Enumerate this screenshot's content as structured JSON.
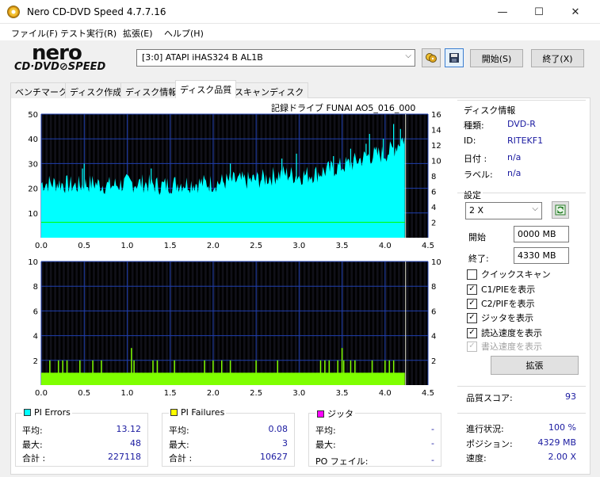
{
  "window": {
    "title": "Nero CD-DVD Speed 4.7.7.16",
    "minimize": "—",
    "maximize": "☐",
    "close": "✕"
  },
  "menu": [
    "ファイル(F)",
    "テスト実行(R)",
    "拡張(E)",
    "ヘルプ(H)"
  ],
  "logo": {
    "brand": "nero",
    "product": "CD·DVD⊘SPEED"
  },
  "toolbar": {
    "drive": "[3:0]   ATAPI iHAS324   B AL1B",
    "start_label": "開始(S)",
    "exit_label": "終了(X)"
  },
  "tabs": [
    "ベンチマーク",
    "ディスク作成",
    "ディスク情報",
    "ディスク品質",
    "スキャンディスク"
  ],
  "active_tab": 3,
  "chart_header": "記録ドライブ FUNAI    AO5_016_000",
  "chart_data": [
    {
      "type": "area",
      "name": "PI Errors",
      "x_ticks": [
        "0.0",
        "0.5",
        "1.0",
        "1.5",
        "2.0",
        "2.5",
        "3.0",
        "3.5",
        "4.0",
        "4.5"
      ],
      "xlim": [
        0,
        4.5
      ],
      "ylim_left": [
        0,
        50
      ],
      "y_ticks_left": [
        "10",
        "20",
        "30",
        "40",
        "50"
      ],
      "ylim_right": [
        0,
        16
      ],
      "y_ticks_right": [
        "2",
        "4",
        "6",
        "8",
        "10",
        "12",
        "14",
        "16"
      ],
      "color": "#00ffff",
      "speed_line_color": "#00ff00",
      "speed_level": 2,
      "grid": true,
      "end_marker_x": 4.23,
      "envelope": [
        [
          0.0,
          22
        ],
        [
          0.2,
          22
        ],
        [
          0.4,
          21
        ],
        [
          0.6,
          22
        ],
        [
          0.8,
          21
        ],
        [
          1.0,
          22
        ],
        [
          1.2,
          22
        ],
        [
          1.4,
          21
        ],
        [
          1.6,
          22
        ],
        [
          1.8,
          22
        ],
        [
          2.0,
          22
        ],
        [
          2.2,
          23
        ],
        [
          2.4,
          23
        ],
        [
          2.6,
          24
        ],
        [
          2.8,
          26
        ],
        [
          3.0,
          25
        ],
        [
          3.2,
          26
        ],
        [
          3.4,
          28
        ],
        [
          3.6,
          30
        ],
        [
          3.8,
          33
        ],
        [
          4.0,
          34
        ],
        [
          4.1,
          36
        ],
        [
          4.2,
          40
        ],
        [
          4.23,
          40
        ]
      ],
      "spikes": [
        [
          0.48,
          28
        ],
        [
          0.5,
          30
        ],
        [
          1.28,
          28
        ],
        [
          2.2,
          30
        ],
        [
          2.8,
          32
        ],
        [
          2.97,
          34
        ],
        [
          3.4,
          33
        ],
        [
          3.6,
          36
        ],
        [
          3.78,
          38
        ],
        [
          3.82,
          42
        ],
        [
          3.98,
          40
        ],
        [
          4.1,
          46
        ],
        [
          4.18,
          44
        ],
        [
          4.2,
          38
        ]
      ]
    },
    {
      "type": "bar",
      "name": "PI Failures",
      "x_ticks": [
        "0.0",
        "0.5",
        "1.0",
        "1.5",
        "2.0",
        "2.5",
        "3.0",
        "3.5",
        "4.0",
        "4.5"
      ],
      "xlim": [
        0,
        4.5
      ],
      "ylim_left": [
        0,
        10
      ],
      "y_ticks_left": [
        "2",
        "4",
        "6",
        "8",
        "10"
      ],
      "ylim_right": [
        0,
        10
      ],
      "y_ticks_right": [
        "2",
        "4",
        "6",
        "8",
        "10"
      ],
      "color": "#7fff00",
      "grid": true,
      "end_marker_x": 4.23,
      "baseline": 1,
      "spikes": [
        [
          0.1,
          2
        ],
        [
          0.2,
          2
        ],
        [
          0.25,
          2
        ],
        [
          0.3,
          2
        ],
        [
          0.45,
          2
        ],
        [
          0.6,
          2
        ],
        [
          0.7,
          2
        ],
        [
          1.05,
          3
        ],
        [
          1.08,
          2
        ],
        [
          1.3,
          2
        ],
        [
          1.35,
          2
        ],
        [
          1.55,
          2
        ],
        [
          1.9,
          2
        ],
        [
          2.0,
          2
        ],
        [
          2.1,
          2
        ],
        [
          2.2,
          2
        ],
        [
          2.5,
          2
        ],
        [
          2.75,
          2
        ],
        [
          3.25,
          2
        ],
        [
          3.3,
          2
        ],
        [
          3.35,
          2
        ],
        [
          3.45,
          2
        ],
        [
          3.5,
          3
        ],
        [
          3.52,
          2
        ],
        [
          3.6,
          2
        ],
        [
          3.65,
          2
        ],
        [
          3.85,
          2
        ],
        [
          4.0,
          2
        ],
        [
          4.05,
          2
        ],
        [
          4.1,
          2
        ]
      ]
    }
  ],
  "stats": {
    "pie": {
      "title": "PI Errors",
      "color": "#00ffff",
      "avg_label": "平均:",
      "avg": "13.12",
      "max_label": "最大:",
      "max": "48",
      "total_label": "合計 :",
      "total": "227118"
    },
    "pif": {
      "title": "PI Failures",
      "color": "#ffff00",
      "avg_label": "平均:",
      "avg": "0.08",
      "max_label": "最大:",
      "max": "3",
      "total_label": "合計 :",
      "total": "10627"
    },
    "jitter": {
      "title": "ジッタ",
      "color": "#ff00ff",
      "avg_label": "平均:",
      "avg": "-",
      "max_label": "最大:",
      "max": "-",
      "po_label": "PO フェイル:",
      "po": "-"
    }
  },
  "disc_info": {
    "title": "ディスク情報",
    "type_label": "種類:",
    "type": "DVD-R",
    "id_label": "ID:",
    "id": "RITEKF1",
    "date_label": "日付 :",
    "date": "n/a",
    "label_label": "ラベル:",
    "label": "n/a"
  },
  "settings": {
    "title": "設定",
    "speed": "2 X",
    "start_label": "開始",
    "start_value": "0000 MB",
    "end_label": "終了:",
    "end_value": "4330 MB",
    "checks": [
      {
        "label": "クイックスキャン",
        "checked": false,
        "disabled": false
      },
      {
        "label": "C1/PIEを表示",
        "checked": true,
        "disabled": false
      },
      {
        "label": "C2/PIFを表示",
        "checked": true,
        "disabled": false
      },
      {
        "label": "ジッタを表示",
        "checked": true,
        "disabled": false
      },
      {
        "label": "読込速度を表示",
        "checked": true,
        "disabled": false
      },
      {
        "label": "書込速度を表示",
        "checked": true,
        "disabled": true
      }
    ],
    "advanced_label": "拡張"
  },
  "quality": {
    "label": "品質スコア:",
    "value": "93"
  },
  "progress": {
    "status_label": "進行状況:",
    "status": "100 %",
    "position_label": "ポジション:",
    "position": "4329 MB",
    "speed_label": "速度:",
    "speed": "2.00 X"
  }
}
